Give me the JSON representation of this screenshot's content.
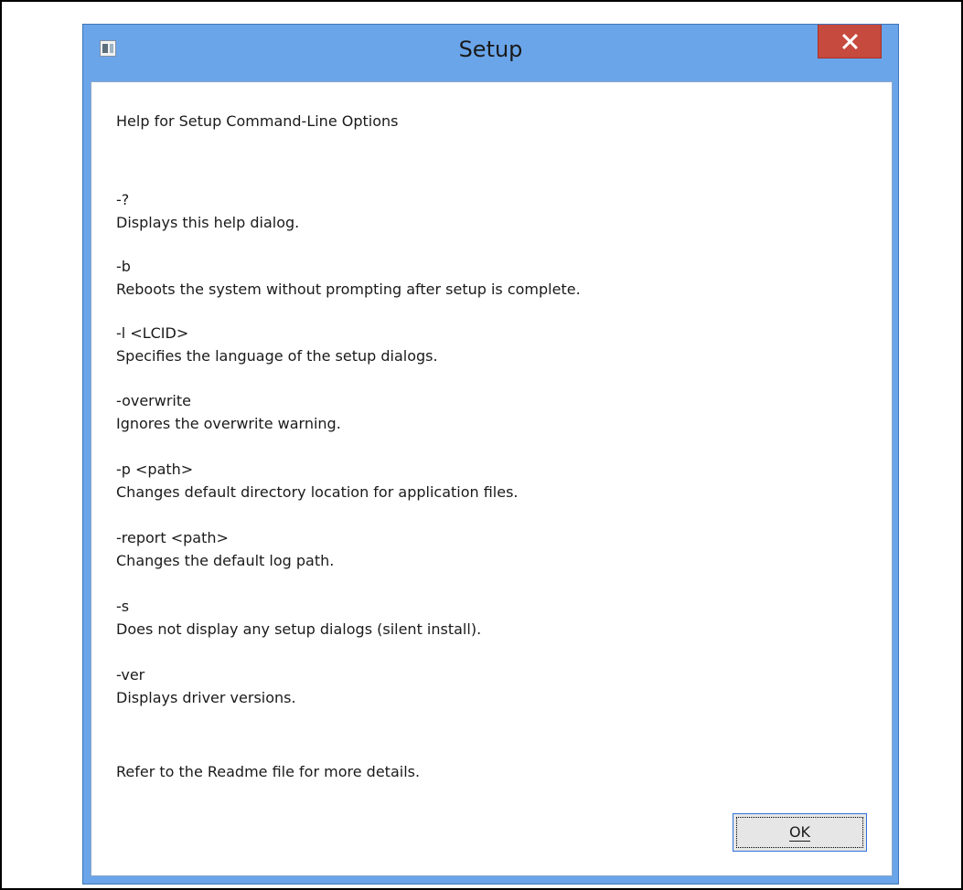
{
  "window": {
    "title": "Setup"
  },
  "dialog": {
    "heading": "Help for Setup Command-Line Options",
    "options": [
      {
        "switch": "-?",
        "description": "Displays this help dialog."
      },
      {
        "switch": "-b",
        "description": "Reboots the system without prompting after setup is complete."
      },
      {
        "switch": "-l <LCID>",
        "description": "Specifies the language of the setup dialogs."
      },
      {
        "switch": "-overwrite",
        "description": "Ignores the overwrite warning."
      },
      {
        "switch": "-p <path>",
        "description": "Changes default directory location for application files."
      },
      {
        "switch": "-report <path>",
        "description": "Changes the default log path."
      },
      {
        "switch": "-s",
        "description": "Does not display any setup dialogs (silent install)."
      },
      {
        "switch": "-ver",
        "description": "Displays driver versions."
      }
    ],
    "footer": "Refer to the Readme file for more details.",
    "ok_label": "OK"
  },
  "colors": {
    "window_frame": "#6aa5ea",
    "close_button": "#c74a3e",
    "ok_button_border": "#2f72d7"
  },
  "icons": {
    "app": "setup-app-icon",
    "close": "close-icon"
  }
}
